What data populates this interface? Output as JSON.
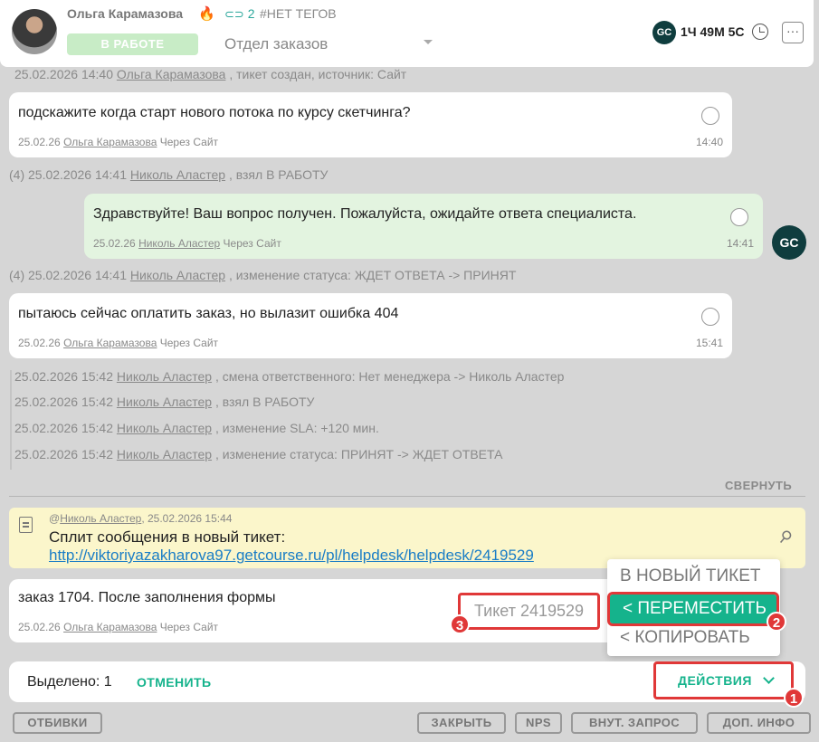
{
  "header": {
    "client_name": "Ольга Карамазова",
    "fire_icon": "🔥",
    "link_count": "2",
    "link_icon": "⊂⊃",
    "tags": "#НЕТ ТЕГОВ",
    "status": "В РАБОТЕ",
    "department": "Отдел заказов",
    "gc_logo": "GC",
    "timer": "1Ч 49М 5С",
    "more": "···"
  },
  "log": [
    {
      "date": "25.02.2026 14:40",
      "user": "Ольга Карамазова",
      "text": ", тикет создан, источник: Сайт"
    },
    {
      "date": "(4) 25.02.2026 14:41",
      "user": "Николь Аластер",
      "text": ", взял В РАБОТУ"
    },
    {
      "date": "(4) 25.02.2026 14:41",
      "user": "Николь Аластер",
      "text": ", изменение статуса: ЖДЕТ ОТВЕТА -> ПРИНЯТ"
    },
    {
      "date": "25.02.2026 15:42",
      "user": "Николь Аластер",
      "text": ", смена ответственного: Нет менеджера -> Николь Аластер"
    },
    {
      "date": "25.02.2026 15:42",
      "user": "Николь Аластер",
      "text": ", взял В РАБОТУ"
    },
    {
      "date": "25.02.2026 15:42",
      "user": "Николь Аластер",
      "text": ", изменение SLA: +120 мин."
    },
    {
      "date": "25.02.2026 15:42",
      "user": "Николь Аластер",
      "text": ", изменение статуса: ПРИНЯТ -> ЖДЕТ ОТВЕТА"
    }
  ],
  "messages": [
    {
      "text": "подскажите когда старт нового потока по курсу скетчинга?",
      "date": "25.02.26",
      "user": "Ольга Карамазова",
      "via": "Через Сайт",
      "time": "14:40"
    },
    {
      "text": "Здравствуйте! Ваш вопрос получен. Пожалуйста, ожидайте ответа специалиста.",
      "date": "25.02.26",
      "user": "Николь Аластер",
      "via": "Через Сайт",
      "time": "14:41"
    },
    {
      "text": "пытаюсь сейчас оплатить заказ, но вылазит ошибка 404",
      "date": "25.02.26",
      "user": "Ольга Карамазова",
      "via": "Через Сайт",
      "time": "15:41"
    },
    {
      "text": "заказ 1704. После заполнения формы",
      "date": "25.02.26",
      "user": "Ольга Карамазова",
      "via": "Через Сайт",
      "time": ""
    }
  ],
  "staff_avatar": "GC",
  "collapse_label": "СВЕРНУТЬ",
  "split_note": {
    "prefix": "@",
    "user": "Николь Аластер",
    "date": ", 25.02.2026 15:44",
    "title": "Сплит сообщения в новый тикет:",
    "link": "http://viktoriyazakharova97.getcourse.ru/pl/helpdesk/helpdesk/2419529",
    "pin_icon": "📌"
  },
  "dropdown": {
    "items": [
      "В НОВЫЙ ТИКЕТ",
      "< ПЕРЕМЕСТИТЬ",
      "< КОПИРОВАТЬ"
    ]
  },
  "ticket_input": "Тикет 2419529",
  "selection": {
    "count_label": "Выделено: 1",
    "cancel": "ОТМЕНИТЬ",
    "actions": "ДЕЙСТВИЯ"
  },
  "badges": [
    "1",
    "2",
    "3"
  ],
  "footer": {
    "replies": "ОТБИВКИ",
    "close": "ЗАКРЫТЬ",
    "nps": "NPS",
    "internal": "ВНУТ. ЗАПРОС",
    "info": "ДОП. ИНФО"
  },
  "colors": {
    "accent": "#15b38c",
    "highlight_red": "#e03838",
    "note_bg": "#fbf6cb",
    "staff_bubble": "#e3f4e0",
    "brand_dark": "#0f3d3e"
  }
}
